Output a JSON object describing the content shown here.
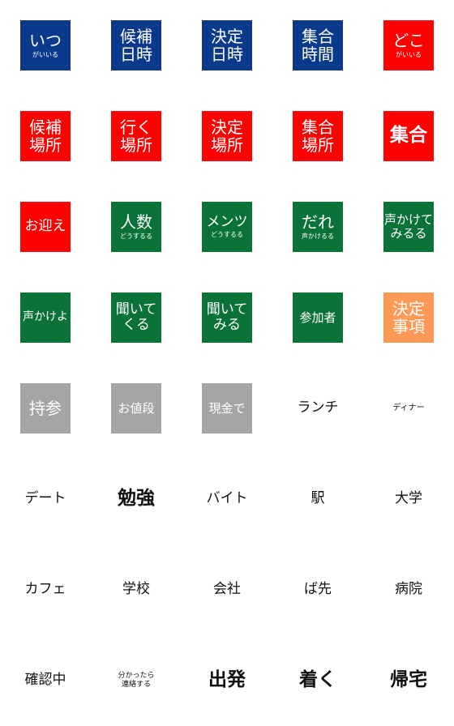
{
  "colors": {
    "blue": "#0b3a8c",
    "red": "#ff0000",
    "green": "#0a7138",
    "orange": "#ff9955",
    "gray": "#a5a5a5"
  },
  "stickers": [
    {
      "lines": [
        "いつ",
        "がいいる"
      ],
      "color": "#0b3a8c"
    },
    {
      "lines": [
        "候補",
        "日時"
      ],
      "color": "#0b3a8c"
    },
    {
      "lines": [
        "決定",
        "日時"
      ],
      "color": "#0b3a8c"
    },
    {
      "lines": [
        "集合",
        "時間"
      ],
      "color": "#0b3a8c"
    },
    {
      "lines": [
        "どこ",
        "がいいる"
      ],
      "color": "#ff0000"
    },
    {
      "lines": [
        "候補",
        "場所"
      ],
      "color": "#ff0000"
    },
    {
      "lines": [
        "行く",
        "場所"
      ],
      "color": "#ff0000"
    },
    {
      "lines": [
        "決定",
        "場所"
      ],
      "color": "#ff0000"
    },
    {
      "lines": [
        "集合",
        "場所"
      ],
      "color": "#ff0000"
    },
    {
      "lines": [
        "集合"
      ],
      "color": "#ff0000"
    },
    {
      "lines": [
        "お迎え"
      ],
      "color": "#ff0000"
    },
    {
      "lines": [
        "人数",
        "どうするる"
      ],
      "color": "#0a7138"
    },
    {
      "lines": [
        "メンツ",
        "どうするる"
      ],
      "color": "#0a7138"
    },
    {
      "lines": [
        "だれ",
        "声かけるる"
      ],
      "color": "#0a7138"
    },
    {
      "lines": [
        "声かけて",
        "みるる"
      ],
      "color": "#0a7138"
    },
    {
      "lines": [
        "声かけよ"
      ],
      "color": "#0a7138"
    },
    {
      "lines": [
        "聞いて",
        "くる"
      ],
      "color": "#0a7138"
    },
    {
      "lines": [
        "聞いて",
        "みる"
      ],
      "color": "#0a7138"
    },
    {
      "lines": [
        "参加者"
      ],
      "color": "#0a7138"
    },
    {
      "lines": [
        "決定",
        "事項"
      ],
      "color": "#ff9955"
    },
    {
      "lines": [
        "持参"
      ],
      "color": "#a5a5a5"
    },
    {
      "lines": [
        "お値段"
      ],
      "color": "#a5a5a5"
    },
    {
      "lines": [
        "現金で"
      ],
      "color": "#a5a5a5"
    },
    {
      "lines": [
        "ランチ"
      ],
      "color": ""
    },
    {
      "lines": [
        "ディナー"
      ],
      "color": ""
    },
    {
      "lines": [
        "デート"
      ],
      "color": ""
    },
    {
      "lines": [
        "勉強"
      ],
      "color": ""
    },
    {
      "lines": [
        "バイト"
      ],
      "color": ""
    },
    {
      "lines": [
        "駅"
      ],
      "color": ""
    },
    {
      "lines": [
        "大学"
      ],
      "color": ""
    },
    {
      "lines": [
        "カフェ"
      ],
      "color": ""
    },
    {
      "lines": [
        "学校"
      ],
      "color": ""
    },
    {
      "lines": [
        "会社"
      ],
      "color": ""
    },
    {
      "lines": [
        "ば先"
      ],
      "color": ""
    },
    {
      "lines": [
        "病院"
      ],
      "color": ""
    },
    {
      "lines": [
        "確認中"
      ],
      "color": ""
    },
    {
      "lines": [
        "分かったら",
        "連絡する"
      ],
      "color": ""
    },
    {
      "lines": [
        "出発"
      ],
      "color": ""
    },
    {
      "lines": [
        "着く"
      ],
      "color": ""
    },
    {
      "lines": [
        "帰宅"
      ],
      "color": ""
    }
  ]
}
